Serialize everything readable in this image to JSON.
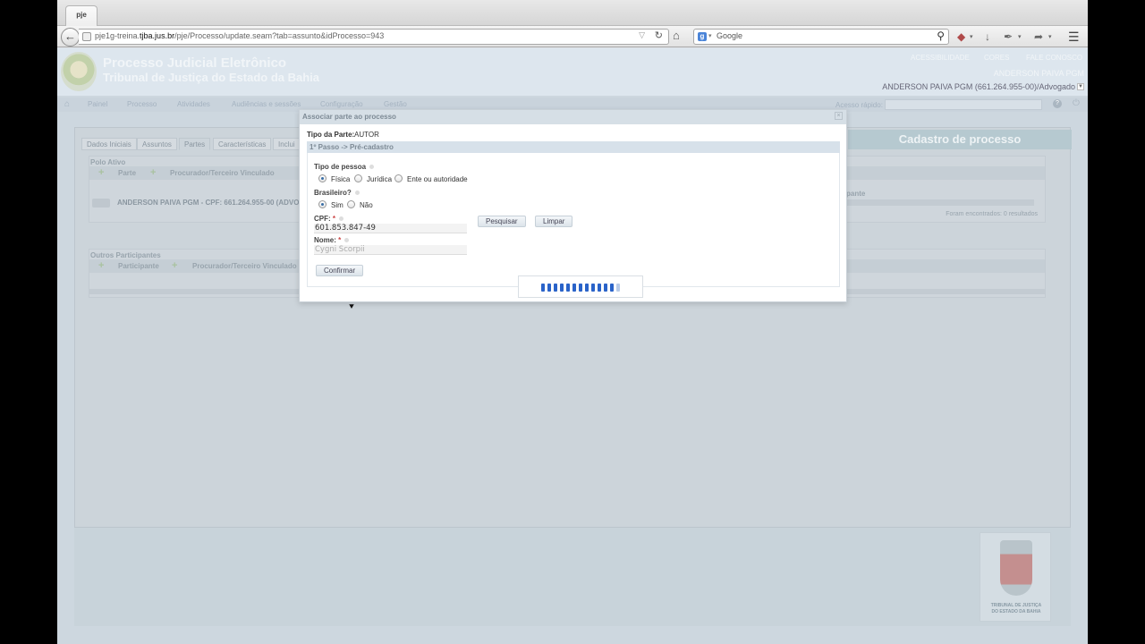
{
  "browser": {
    "tab_label": "pje",
    "url_prefix": "pje1g-treina.",
    "url_host": "tjba.jus.br",
    "url_path": "/pje/Processo/update.seam?tab=assunto&idProcesso=943",
    "search_placeholder": "Google"
  },
  "header": {
    "title": "Processo Judicial Eletrônico",
    "subtitle": "Tribunal de Justiça do Estado da Bahia",
    "links": [
      "ACESSIBILIDADE",
      "CORES",
      "FALE CONOSCO"
    ],
    "user_name": "ANDERSON PAIVA PGM",
    "user_full": "ANDERSON PAIVA PGM (661.264.955-00)/Advogado"
  },
  "menu": {
    "items": [
      "Painel",
      "Processo",
      "Atividades",
      "Audiências e sessões",
      "Configuração",
      "Gestão"
    ],
    "quick_access_label": "Acesso rápido:"
  },
  "process_tabs": [
    "Dados Iniciais",
    "Assuntos",
    "Partes",
    "Características",
    "Inclui"
  ],
  "cadastro_title": "Cadastro de processo",
  "polo_ativo": {
    "title": "Polo Ativo",
    "columns": [
      "Parte",
      "Procurador/Terceiro Vinculado"
    ],
    "row_text": "ANDERSON PAIVA PGM - CPF: 661.264.955-00 (ADVOGA",
    "right_label": "pante",
    "found_text": "Foram encontrados: 0 resultados"
  },
  "outros": {
    "title": "Outros Participantes",
    "columns": [
      "Participante",
      "Procurador/Terceiro Vinculado"
    ]
  },
  "footer_logo": {
    "caption_line1": "TRIBUNAL DE JUSTIÇA",
    "caption_line2": "DO ESTADO DA BAHIA"
  },
  "modal": {
    "title": "Associar parte ao processo",
    "tipo_parte_label": "Tipo da Parte:",
    "tipo_parte_value": "AUTOR",
    "step_label": "1º Passo -> Pré-cadastro",
    "tipo_pessoa_label": "Tipo de pessoa",
    "tipo_pessoa_options": [
      "Física",
      "Jurídica",
      "Ente ou autoridade"
    ],
    "tipo_pessoa_selected": "Física",
    "brasileiro_label": "Brasileiro?",
    "brasileiro_options": [
      "Sim",
      "Não"
    ],
    "brasileiro_selected": "Sim",
    "cpf_label": "CPF:",
    "cpf_value": "601.853.847-49",
    "nome_label": "Nome:",
    "nome_value": "Cygni Scorpii",
    "pesquisar_label": "Pesquisar",
    "limpar_label": "Limpar",
    "confirmar_label": "Confirmar",
    "loading_progress": 0.92
  }
}
